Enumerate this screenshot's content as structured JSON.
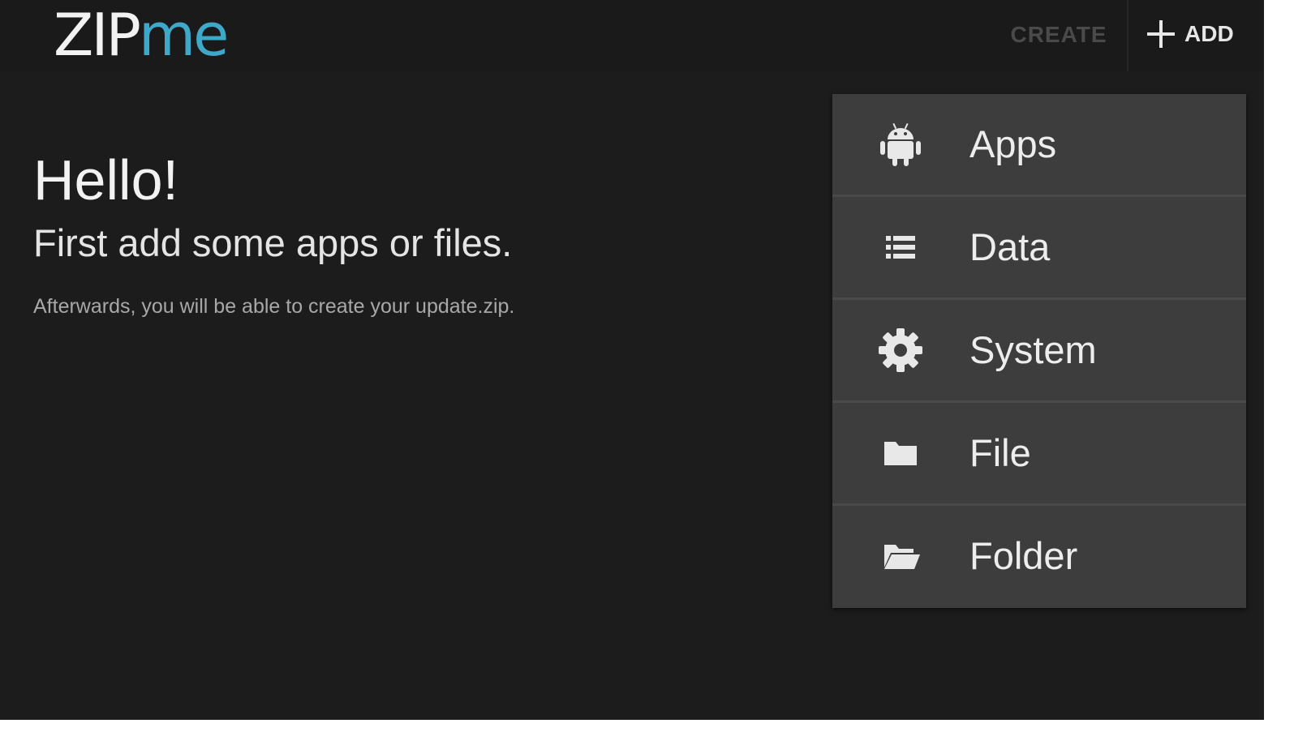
{
  "app": {
    "logo_part1": "ZIP",
    "logo_part2": "me",
    "accent_color": "#3fa8c8"
  },
  "actionbar": {
    "create_label": "CREATE",
    "create_enabled": false,
    "add_label": "ADD",
    "add_icon": "plus-icon"
  },
  "main": {
    "greeting": "Hello!",
    "instruction": "First add some apps or files.",
    "hint": "Afterwards, you will be able to create your update.zip."
  },
  "add_menu": {
    "items": [
      {
        "label": "Apps",
        "icon": "android-icon"
      },
      {
        "label": "Data",
        "icon": "list-icon"
      },
      {
        "label": "System",
        "icon": "gear-icon"
      },
      {
        "label": "File",
        "icon": "file-icon"
      },
      {
        "label": "Folder",
        "icon": "folder-icon"
      }
    ]
  }
}
